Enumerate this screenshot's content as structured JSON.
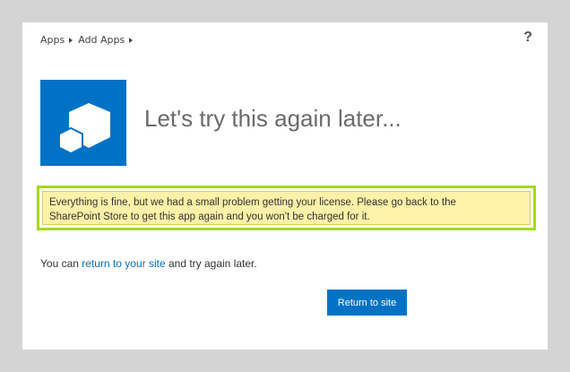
{
  "breadcrumb": {
    "items": [
      "Apps",
      "Add Apps"
    ]
  },
  "help": {
    "glyph": "?"
  },
  "app_tile": {
    "icon": "sharepoint-app-cubes-icon",
    "color": "#0072c6"
  },
  "heading": {
    "title": "Let's try this again later..."
  },
  "notice": {
    "line1": "Everything is fine, but we had a small problem getting your license. Please go back to the",
    "line2": "SharePoint Store to get this app again and you won't be charged for it.",
    "border_color": "#a4d91c",
    "background_color": "#fff1a8"
  },
  "status": {
    "prefix": "You can ",
    "link_text": "return to your site",
    "suffix": " and try again later."
  },
  "actions": {
    "return_button_label": "Return to site"
  },
  "colors": {
    "accent": "#0072c6",
    "page_background": "#d4d4d4"
  }
}
